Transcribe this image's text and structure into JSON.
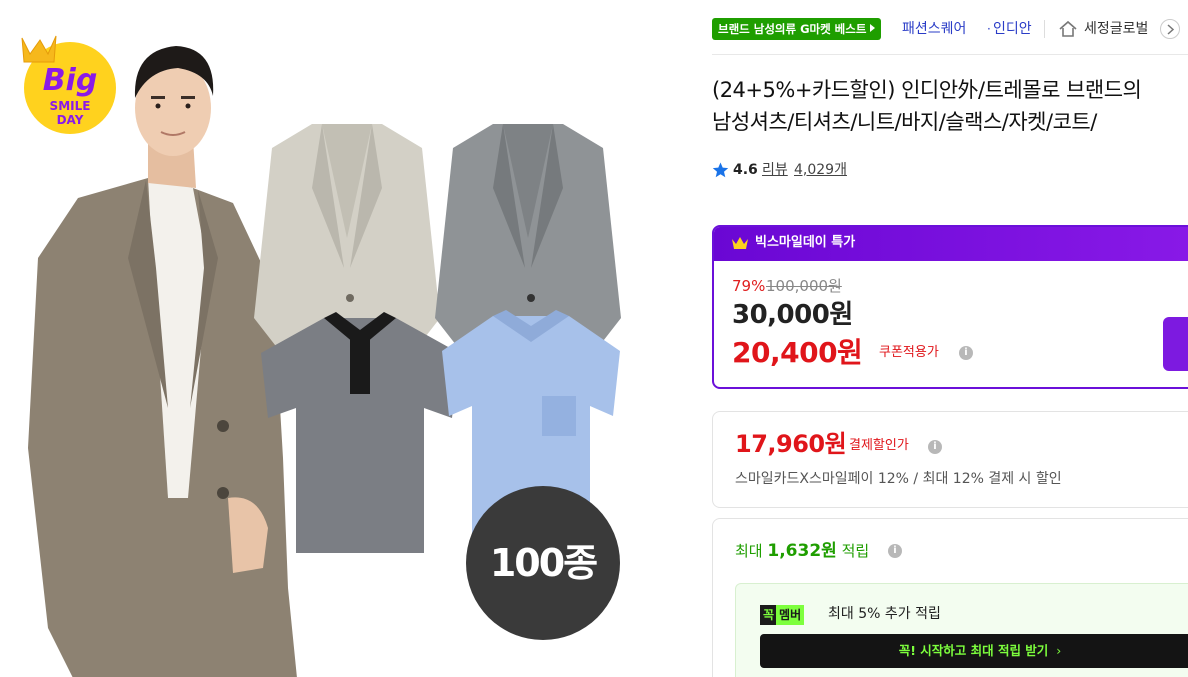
{
  "badge": {
    "big_text": "Big",
    "line2": "SMILE",
    "line3": "DAY"
  },
  "product_image": {
    "count_label": "100종"
  },
  "header": {
    "best_tag": "브랜드 남성의류 G마켓 베스트",
    "brand_primary": "패션스퀘어",
    "brand_dot": "·",
    "brand_secondary": "인디안",
    "shop_name": "세정글로벌"
  },
  "title": {
    "line1": "(24+5%+카드할인) 인디안外/트레몰로 브랜드의",
    "line2": "남성셔츠/티셔츠/니트/바지/슬랙스/자켓/코트/"
  },
  "rating": {
    "value": "4.6",
    "review_label": "리뷰",
    "review_count": "4,029개"
  },
  "promo": {
    "title": "빅스마일데이 특가",
    "discount_rate": "79%",
    "original_price": "100,000원",
    "sale_price": "30,000원",
    "coupon_price": "20,400원",
    "coupon_label": "쿠폰적용가"
  },
  "payment": {
    "price": "17,960원",
    "label": "결제할인가",
    "description": "스마일카드X스마일페이 12% / 최대 12% 결제 시 할인"
  },
  "points": {
    "prefix": "최대",
    "amount": "1,632원",
    "suffix": "적립",
    "member_logo_1": "꼭",
    "member_logo_2": "멤버",
    "member_desc": "최대 5% 추가 적립",
    "member_button": "꼭! 시작하고 최대 적립 받기"
  },
  "colors": {
    "accent_purple": "#6b10d9",
    "sale_red": "#e0151a",
    "point_green": "#1f9e00",
    "brand_blue": "#2a3cc7"
  },
  "icons": [
    "crown-icon",
    "home-icon",
    "chevron-right-icon",
    "star-icon",
    "info-icon"
  ]
}
